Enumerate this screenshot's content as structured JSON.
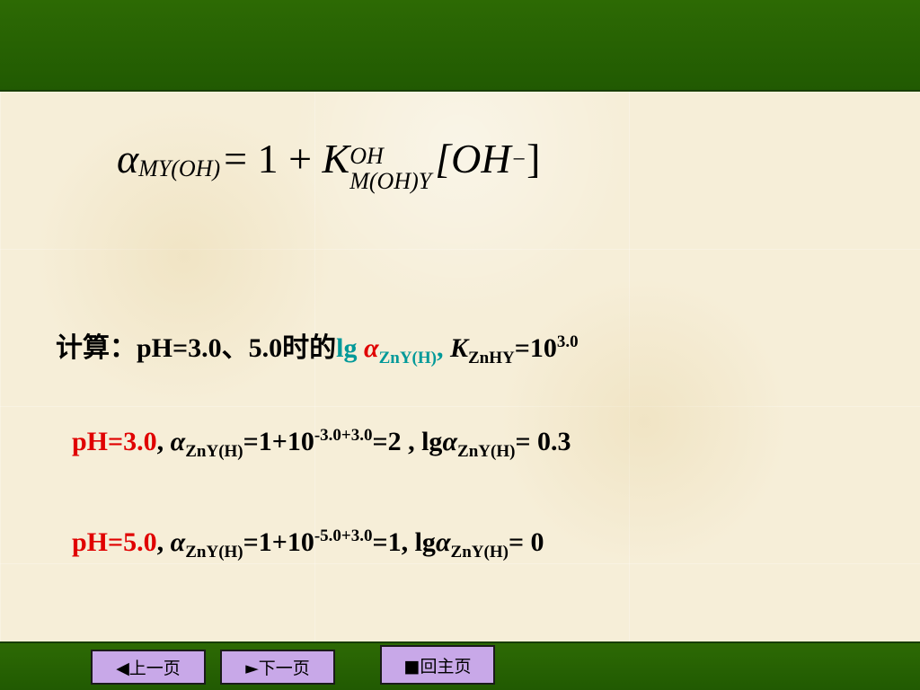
{
  "formula": {
    "alpha": "α",
    "alpha_sub": "MY(OH)",
    "equals_one_plus": "= 1 + ",
    "K": "K",
    "K_sup": "OH",
    "K_sub": "M(OH)Y",
    "bracket_content": "[OH",
    "bracket_sup": "−",
    "bracket_close": "]"
  },
  "line1": {
    "prefix": "计算：pH=3.0、5.0时的",
    "lg": "lg ",
    "alpha": "α",
    "alpha_sub": "ZnY(H)",
    "comma": ",",
    "K": "K",
    "K_sub": "ZnHY",
    "eq": "=10",
    "exp": "3.0"
  },
  "line2": {
    "ph": "pH=3.0",
    "comma": ", ",
    "alpha": "α",
    "alpha_sub": "ZnY(H)",
    "eq": "=1+10",
    "exp": "-3.0+3.0",
    "result": "=2 , lg",
    "alpha2": "α",
    "alpha2_sub": "ZnY(H)",
    "final": "= 0.3"
  },
  "line3": {
    "ph": "pH=5.0",
    "comma": ", ",
    "alpha": "α",
    "alpha_sub": "ZnY(H)",
    "eq": "=1+10",
    "exp": "-5.0+3.0",
    "result": "=1,  lg",
    "alpha2": "α",
    "alpha2_sub": "ZnY(H)",
    "final": "= 0"
  },
  "nav": {
    "prev": "◀上一页",
    "next": "►下一页",
    "home": "■回主页"
  },
  "colors": {
    "bar_green": "#2d6a04",
    "button_purple": "#c8a8e8",
    "highlight_red": "#e00000",
    "highlight_teal": "#009999"
  }
}
